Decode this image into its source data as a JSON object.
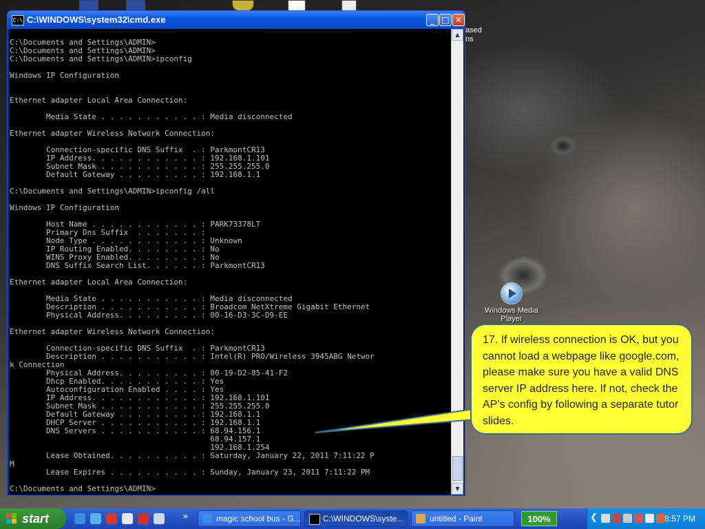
{
  "window": {
    "title": "C:\\WINDOWS\\system32\\cmd.exe",
    "icon_label": "C:\\",
    "buttons": {
      "minimize": "_",
      "maximize": "□",
      "close": "✕"
    }
  },
  "console_lines": [
    "C:\\Documents and Settings\\ADMIN>",
    "C:\\Documents and Settings\\ADMIN>",
    "C:\\Documents and Settings\\ADMIN>ipconfig",
    "",
    "Windows IP Configuration",
    "",
    "",
    "Ethernet adapter Local Area Connection:",
    "",
    "        Media State . . . . . . . . . . . : Media disconnected",
    "",
    "Ethernet adapter Wireless Network Connection:",
    "",
    "        Connection-specific DNS Suffix  . : ParkmontCR13",
    "        IP Address. . . . . . . . . . . . : 192.168.1.101",
    "        Subnet Mask . . . . . . . . . . . : 255.255.255.0",
    "        Default Gateway . . . . . . . . . : 192.168.1.1",
    "",
    "C:\\Documents and Settings\\ADMIN>ipconfig /all",
    "",
    "Windows IP Configuration",
    "",
    "        Host Name . . . . . . . . . . . . : PARK73378LT",
    "        Primary Dns Suffix  . . . . . . . :",
    "        Node Type . . . . . . . . . . . . : Unknown",
    "        IP Routing Enabled. . . . . . . . : No",
    "        WINS Proxy Enabled. . . . . . . . : No",
    "        DNS Suffix Search List. . . . . . : ParkmontCR13",
    "",
    "Ethernet adapter Local Area Connection:",
    "",
    "        Media State . . . . . . . . . . . : Media disconnected",
    "        Description . . . . . . . . . . . : Broadcom NetXtreme Gigabit Ethernet",
    "        Physical Address. . . . . . . . . : 00-16-D3-3C-D9-EE",
    "",
    "Ethernet adapter Wireless Network Connection:",
    "",
    "        Connection-specific DNS Suffix  . : ParkmontCR13",
    "        Description . . . . . . . . . . . : Intel(R) PRO/Wireless 3945ABG Networ",
    "k Connection",
    "        Physical Address. . . . . . . . . : 00-19-D2-85-41-F2",
    "        Dhcp Enabled. . . . . . . . . . . : Yes",
    "        Autoconfiguration Enabled . . . . : Yes",
    "        IP Address. . . . . . . . . . . . : 192.168.1.101",
    "        Subnet Mask . . . . . . . . . . . : 255.255.255.0",
    "        Default Gateway . . . . . . . . . : 192.168.1.1",
    "        DHCP Server . . . . . . . . . . . : 192.168.1.1",
    "        DNS Servers . . . . . . . . . . . : 68.94.156.1",
    "                                            68.94.157.1",
    "                                            192.168.1.254",
    "        Lease Obtained. . . . . . . . . . : Saturday, January 22, 2011 7:11:22 P",
    "M",
    "        Lease Expires . . . . . . . . . . : Sunday, January 23, 2011 7:11:22 PM",
    "",
    "C:\\Documents and Settings\\ADMIN>"
  ],
  "scrollbar": {
    "up_arrow": "▲",
    "down_arrow": "▼"
  },
  "callout": {
    "text": "17. If wireless connection is OK, but you cannot load a webpage like google.com, please make sure you have a valid DNS server IP address here. If not, check the AP’s config by following a separate tutor slides.",
    "background": "#ffff33",
    "border_color": "#3a6e8f"
  },
  "desktop": {
    "wmp_icon_label": "Windows Media Player",
    "edge_text_top": "ased",
    "edge_text_top2": "ns"
  },
  "taskbar": {
    "start_label": "start",
    "quicklaunch_more": "»",
    "tasks": [
      {
        "label": "magic school bus - G...",
        "icon": "ie-icon",
        "active": false
      },
      {
        "label": "C:\\WINDOWS\\syste...",
        "icon": "cmd-icon",
        "active": true
      },
      {
        "label": "untitled - Paint",
        "icon": "paint-icon",
        "active": false
      }
    ],
    "zoom": "100%",
    "tray_arrow": "❮",
    "clock": "8:57 PM"
  },
  "colors": {
    "titlebar": "#0a58e0",
    "console_bg": "#000000",
    "console_fg": "#c0c0c0",
    "start_green": "#2f8a2f",
    "tray_blue": "#0d7fd8"
  }
}
